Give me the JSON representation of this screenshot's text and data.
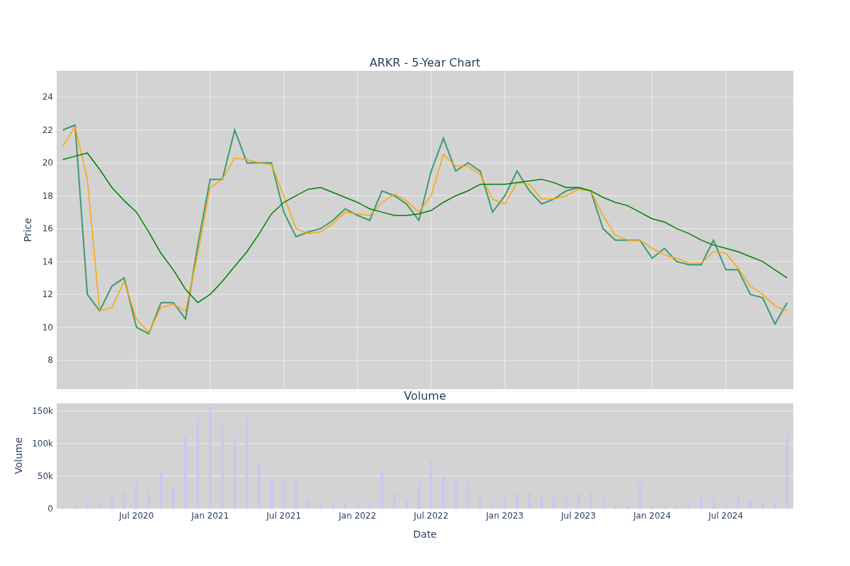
{
  "price_panel": {
    "chart_data": {
      "type": "line",
      "title": "ARKR - 5-Year Chart",
      "ylabel": "Price",
      "categories": [
        null,
        null,
        null,
        null,
        null,
        null,
        null,
        null,
        null,
        null,
        null,
        null,
        null,
        null,
        null,
        null,
        null,
        null,
        null,
        null,
        null,
        null,
        null,
        null,
        null,
        null,
        null,
        null,
        null,
        null,
        null,
        null,
        null,
        null,
        null,
        null,
        null,
        null,
        null,
        null,
        null,
        null,
        null,
        null,
        null,
        null,
        null,
        null,
        null,
        null,
        null,
        null,
        null,
        null,
        null,
        null,
        null,
        null,
        null,
        null
      ],
      "series": [
        {
          "color": "#3d9970",
          "values": [
            22,
            22.3,
            12,
            11,
            12.5,
            13,
            10,
            9.6,
            11.5,
            11.5,
            10.5,
            15,
            19,
            19,
            22,
            20,
            20,
            20,
            17,
            15.5,
            15.8,
            16,
            16.5,
            17.2,
            16.8,
            16.5,
            18.3,
            18,
            17.5,
            16.5,
            19.5,
            21.5,
            19.5,
            20,
            19.5,
            17,
            18,
            19.5,
            18.3,
            17.5,
            17.8,
            18.3,
            18.5,
            18.3,
            16,
            15.3,
            15.3,
            15.3,
            14.2,
            14.8,
            14,
            13.8,
            13.8,
            15.3,
            13.5,
            13.5,
            12,
            11.8,
            10.2,
            11.5
          ]
        },
        {
          "color": "#ffa500",
          "values": [
            21,
            22.2,
            19,
            11,
            11.2,
            12.8,
            10.5,
            9.7,
            11.2,
            11.4,
            11,
            14.5,
            18.5,
            19,
            20.3,
            20.2,
            20,
            19.9,
            18,
            16,
            15.7,
            15.8,
            16.3,
            17,
            16.9,
            16.8,
            17.6,
            18.1,
            17.7,
            17,
            18,
            20.5,
            19.8,
            19.8,
            19.3,
            17.8,
            17.5,
            18.8,
            18.7,
            17.8,
            17.8,
            18,
            18.4,
            18.3,
            16.8,
            15.6,
            15.3,
            15.3,
            14.8,
            14.4,
            14.2,
            13.9,
            13.9,
            14.6,
            14.5,
            13.6,
            12.5,
            12,
            11.3,
            11
          ]
        },
        {
          "color": "#008000",
          "values": [
            20.2,
            20.4,
            20.6,
            19.6,
            18.5,
            17.7,
            17,
            15.8,
            14.5,
            13.5,
            12.3,
            11.5,
            12,
            12.8,
            13.7,
            14.6,
            15.7,
            16.9,
            17.6,
            18,
            18.4,
            18.5,
            18.2,
            17.9,
            17.6,
            17.2,
            17,
            16.8,
            16.8,
            16.9,
            17.1,
            17.6,
            18,
            18.3,
            18.7,
            18.7,
            18.7,
            18.8,
            18.9,
            19,
            18.8,
            18.5,
            18.5,
            18.3,
            17.9,
            17.6,
            17.4,
            17,
            16.6,
            16.4,
            16,
            15.7,
            15.3,
            15,
            14.8,
            14.6,
            14.3,
            14,
            13.5,
            13
          ]
        }
      ],
      "grid": true,
      "ylim": [
        6.24,
        25.6
      ],
      "yticks": [
        {
          "value": 8,
          "label": "8"
        },
        {
          "value": 10,
          "label": "10"
        },
        {
          "value": 12,
          "label": "12"
        },
        {
          "value": 14,
          "label": "14"
        },
        {
          "value": 16,
          "label": "16"
        },
        {
          "value": 18,
          "label": "18"
        },
        {
          "value": 20,
          "label": "20"
        },
        {
          "value": 22,
          "label": "22"
        },
        {
          "value": 24,
          "label": "24"
        }
      ]
    }
  },
  "volume_panel": {
    "chart_data": {
      "type": "bar",
      "title": "Volume",
      "xlabel": "Date",
      "ylabel": "Volume",
      "categories": [
        null,
        null,
        null,
        null,
        null,
        null,
        "Jul 2020",
        null,
        null,
        null,
        null,
        null,
        "Jan 2021",
        null,
        null,
        null,
        null,
        null,
        "Jul 2021",
        null,
        null,
        null,
        null,
        null,
        "Jan 2022",
        null,
        null,
        null,
        null,
        null,
        "Jul 2022",
        null,
        null,
        null,
        null,
        null,
        "Jan 2023",
        null,
        null,
        null,
        null,
        null,
        "Jul 2023",
        null,
        null,
        null,
        null,
        null,
        "Jan 2024",
        null,
        null,
        null,
        null,
        null,
        "Jul 2024",
        null,
        null,
        null,
        null,
        null
      ],
      "series": [
        {
          "color": "#c8c8f0",
          "values": [
            3000,
            5000,
            12000,
            10000,
            15000,
            25000,
            40000,
            30000,
            55000,
            35000,
            110000,
            140000,
            155000,
            130000,
            110000,
            140000,
            70000,
            45000,
            45000,
            48000,
            15000,
            8000,
            8000,
            10000,
            8000,
            10000,
            57000,
            25000,
            15000,
            40000,
            75000,
            50000,
            45000,
            40000,
            20000,
            10000,
            20000,
            25000,
            25000,
            18000,
            20000,
            22000,
            25000,
            25000,
            15000,
            5000,
            5000,
            40000,
            5000,
            5000,
            5000,
            8000,
            18000,
            15000,
            10000,
            18000,
            15000,
            10000,
            10000,
            115000
          ]
        }
      ],
      "grid": true,
      "ylim": [
        0,
        162000
      ],
      "yticks": [
        {
          "value": 0,
          "label": "0"
        },
        {
          "value": 50000,
          "label": "50k"
        },
        {
          "value": 100000,
          "label": "100k"
        },
        {
          "value": 150000,
          "label": "150k"
        }
      ]
    }
  }
}
